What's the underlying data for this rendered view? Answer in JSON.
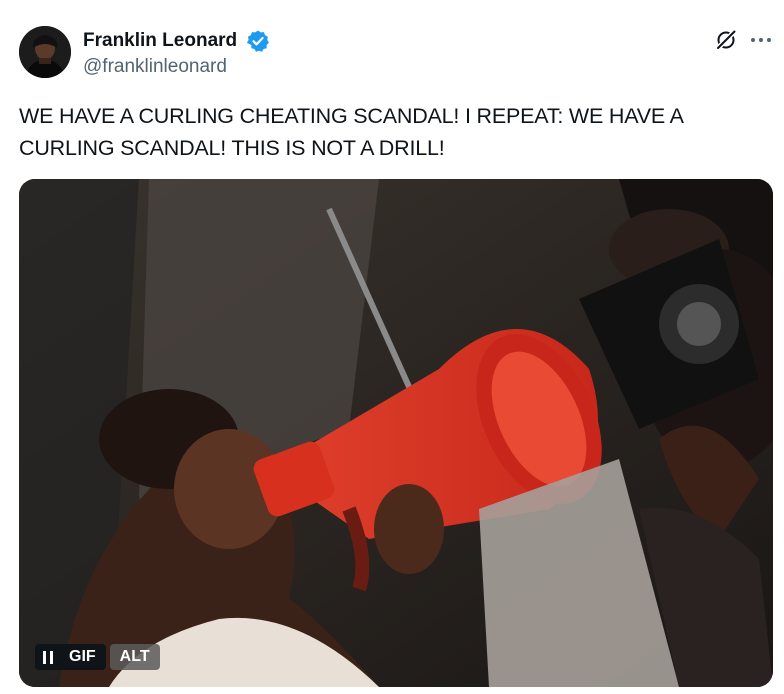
{
  "author": {
    "name": "Franklin Leonard",
    "handle": "@franklinleonard",
    "verified": true
  },
  "tweet": {
    "text": "WE HAVE A CURLING CHEATING SCANDAL! I REPEAT: WE HAVE A CURLING SCANDAL! THIS IS NOT A DRILL!"
  },
  "media": {
    "type": "GIF",
    "gif_label": "GIF",
    "alt_label": "ALT",
    "playing": true
  },
  "icons": {
    "verified": "verified-badge-icon",
    "grok": "grok-icon",
    "more": "more-icon",
    "pause": "pause-icon"
  },
  "colors": {
    "verified_blue": "#1d9bf0",
    "text_primary": "#0f1419",
    "text_secondary": "#536471",
    "megaphone_red": "#d8301f"
  }
}
